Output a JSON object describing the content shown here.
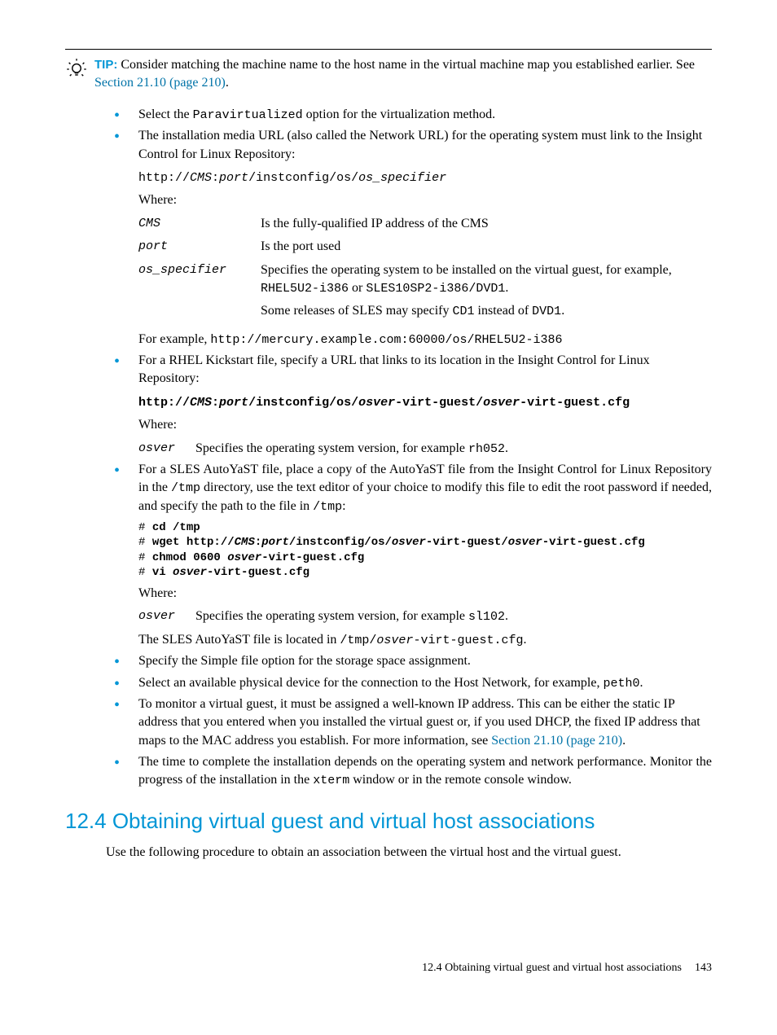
{
  "tip": {
    "label": "TIP:",
    "text_before_link": "Consider matching the machine name to the host name in the virtual machine map you established earlier. See ",
    "link": "Section 21.10 (page 210)",
    "text_after_link": "."
  },
  "bullets_a": {
    "b1_pre": "Select the ",
    "b1_mono": "Paravirtualized",
    "b1_post": " option for the virtualization method.",
    "b2": "The installation media URL (also called the Network URL) for the operating system must link to the Insight Control for Linux Repository:",
    "url_pre": "http://",
    "url_cms": "CMS",
    "url_colon": ":",
    "url_port": "port",
    "url_mid": "/instconfig/os/",
    "url_spec": "os_specifier",
    "where": "Where:",
    "def_cms_term": "CMS",
    "def_cms_desc": "Is the fully-qualified IP address of the CMS",
    "def_port_term": "port",
    "def_port_desc": "Is the port used",
    "def_spec_term": "os_specifier",
    "def_spec_desc_pre": "Specifies the operating system to be installed on the virtual guest, for example, ",
    "def_spec_ex1": "RHEL5U2-i386",
    "def_spec_or": " or ",
    "def_spec_ex2": "SLES10SP2-i386/DVD1",
    "def_spec_desc_post": ".",
    "def_spec_line2_pre": "Some releases of SLES may specify ",
    "def_spec_cd1": "CD1",
    "def_spec_instead": " instead of ",
    "def_spec_dvd1": "DVD1",
    "def_spec_line2_post": ".",
    "example_pre": "For example, ",
    "example_url": "http://mercury.example.com:60000/os/RHEL5U2-i386",
    "b3": "For a RHEL Kickstart file, specify a URL that links to its location in the Insight Control for Linux Repository:",
    "ks_p1": "http://",
    "ks_cms": "CMS",
    "ks_colon": ":",
    "ks_port": "port",
    "ks_p2": "/instconfig/os/",
    "ks_osver": "osver",
    "ks_p3": "-virt-guest/",
    "ks_osver2": "osver",
    "ks_p4": "-virt-guest.cfg",
    "ks_where": "Where:",
    "ks_def_term": "osver",
    "ks_def_desc_pre": "Specifies the operating system version, for example ",
    "ks_def_ex": "rh052",
    "ks_def_desc_post": ".",
    "b4_pre": "For a SLES AutoYaST file, place a copy of the AutoYaST file from the Insight Control for Linux Repository in the ",
    "b4_tmp1": "/tmp",
    "b4_mid": " directory, use the text editor of your choice to modify this file to edit the root password if needed, and specify the path to the file in ",
    "b4_tmp2": "/tmp",
    "b4_post": ":",
    "cmd_hash": "# ",
    "cmd1": "cd /tmp",
    "cmd2_p1": "wget http://",
    "cmd2_cms": "CMS",
    "cmd2_colon": ":",
    "cmd2_port": "port",
    "cmd2_p2": "/instconfig/os/",
    "cmd2_osver": "osver",
    "cmd2_p3": "-virt-guest/",
    "cmd2_osver2": "osver",
    "cmd2_p4": "-virt-guest.cfg",
    "cmd3_p1": "chmod 0600 ",
    "cmd3_osver": "osver",
    "cmd3_p2": "-virt-guest.cfg",
    "cmd4_p1": "vi ",
    "cmd4_osver": "osver",
    "cmd4_p2": "-virt-guest.cfg",
    "ay_where": "Where:",
    "ay_def_term": "osver",
    "ay_def_desc_pre": "Specifies the operating system version, for example ",
    "ay_def_ex": "sl102",
    "ay_def_desc_post": ".",
    "ay_loc_pre": "The SLES AutoYaST file is located in ",
    "ay_loc_path_pre": "/tmp/",
    "ay_loc_osver": "osver",
    "ay_loc_path_post": "-virt-guest.cfg",
    "ay_loc_post": ".",
    "b5": "Specify the Simple file option for the storage space assignment.",
    "b6_pre": "Select an available physical device for the connection to the Host Network, for example, ",
    "b6_mono": "peth0",
    "b6_post": ".",
    "b7_pre": "To monitor a virtual guest, it must be assigned a well-known IP address. This can be either the static IP address that you entered when you installed the virtual guest or, if you used DHCP, the fixed IP address that maps to the MAC address you establish. For more information, see ",
    "b7_link": "Section 21.10 (page 210)",
    "b7_post": ".",
    "b8_pre": "The time to complete the installation depends on the operating system and network performance. Monitor the progress of the installation in the ",
    "b8_mono": "xterm",
    "b8_post": " window or in the remote console window."
  },
  "section": {
    "heading": "12.4 Obtaining virtual guest and virtual host associations",
    "para": "Use the following procedure to obtain an association between the virtual host and the virtual guest."
  },
  "footer": {
    "text": "12.4 Obtaining virtual guest and virtual host associations",
    "page": "143"
  }
}
